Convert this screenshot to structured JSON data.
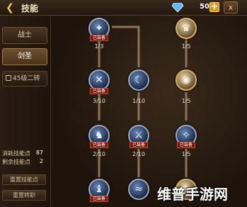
{
  "header": {
    "title": "技能",
    "back_icon": "back-arrow-icon",
    "currency": "50",
    "plus_label": "+",
    "close_label": "x"
  },
  "sidebar": {
    "classes": [
      {
        "label": "战士"
      },
      {
        "label": "剑圣"
      }
    ],
    "locked_label": "45级二转",
    "stats": [
      {
        "label": "消耗技能点",
        "value": "87"
      },
      {
        "label": "剩余技能点",
        "value": "2"
      }
    ],
    "reset_skill_label": "重置技能点",
    "reset_job_label": "重置转职"
  },
  "skills": [
    {
      "name": "skill-1",
      "equipped": "已装备",
      "level": "1/3",
      "glyph": "✦"
    },
    {
      "name": "skill-2",
      "equipped": "",
      "level": "1/5",
      "glyph": "♛"
    },
    {
      "name": "skill-3",
      "equipped": "已装备",
      "level": "3/10",
      "glyph": "✕"
    },
    {
      "name": "skill-4",
      "equipped": "",
      "level": "1/10",
      "glyph": "☾"
    },
    {
      "name": "skill-5",
      "equipped": "",
      "level": "1/5",
      "glyph": "◉"
    },
    {
      "name": "skill-6",
      "equipped": "已装备",
      "level": "2/10",
      "glyph": "♞"
    },
    {
      "name": "skill-7",
      "equipped": "已装备",
      "level": "2/10",
      "glyph": "⚔"
    },
    {
      "name": "skill-8",
      "equipped": "已装备",
      "level": "1/5",
      "glyph": "✧"
    },
    {
      "name": "skill-9",
      "equipped": "已装备",
      "level": "",
      "glyph": "♝"
    },
    {
      "name": "skill-10",
      "equipped": "",
      "level": "",
      "glyph": "≈"
    },
    {
      "name": "skill-11",
      "equipped": "",
      "level": "",
      "glyph": "♔"
    }
  ],
  "watermark": "维普手游网",
  "colors": {
    "accent": "#d89a20",
    "equipped_badge": "#7a1a10"
  }
}
